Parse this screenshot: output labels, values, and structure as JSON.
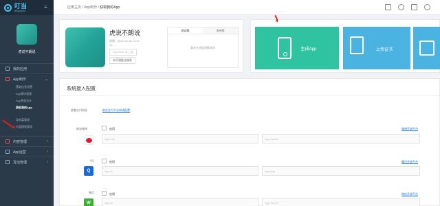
{
  "sidebar": {
    "logo_title": "叮当",
    "logo_subtitle": "dingdone",
    "profile_name": "虎说不朗说",
    "items": [
      {
        "label": "我的应用"
      },
      {
        "label": "App制作"
      },
      {
        "label": "内容管理"
      },
      {
        "label": "App运营"
      },
      {
        "label": "互动管理"
      }
    ],
    "sub_items": [
      {
        "label": "基础信息设置"
      },
      {
        "label": "App模块管理"
      },
      {
        "label": "App界面设计"
      },
      {
        "label": "获取我的App"
      },
      {
        "label": "导航菜管理"
      },
      {
        "label": "内容模版管理"
      }
    ]
  },
  "topbar": {
    "menu_glyph": "≡",
    "breadcrumb": [
      "应用主页",
      "App制作",
      "获取我的App"
    ]
  },
  "app_card": {
    "title": "虎说不朗说",
    "created": "创建：2017-02-18 13:19",
    "id": "ID：--",
    "btn_appstore": "AppStore 未上架",
    "btn_share": "未开通推送服务",
    "tabs": [
      "测试版",
      "发布版"
    ],
    "empty_text": "暂未生成此测版本包"
  },
  "gen_card": {
    "generate_label": "生成App",
    "cert_label": "上传证书"
  },
  "config": {
    "title": "系统接入配置",
    "pay_label": "查看支付授权",
    "pay_link": "前往支付平台申请配置",
    "rows": [
      {
        "label": "新浪微博",
        "enable": "启用",
        "key_placeholder": "App Key",
        "secret_placeholder": "App Secret",
        "help": "微博开放平台"
      },
      {
        "label": "QQ",
        "enable": "启用",
        "key_placeholder": "App ID",
        "secret_placeholder": "App Key",
        "help": "腾讯开放平台"
      },
      {
        "label": "微信",
        "enable": "启用",
        "key_placeholder": "App ID",
        "secret_placeholder": "App Secret",
        "help": "微信开放平台"
      }
    ]
  }
}
